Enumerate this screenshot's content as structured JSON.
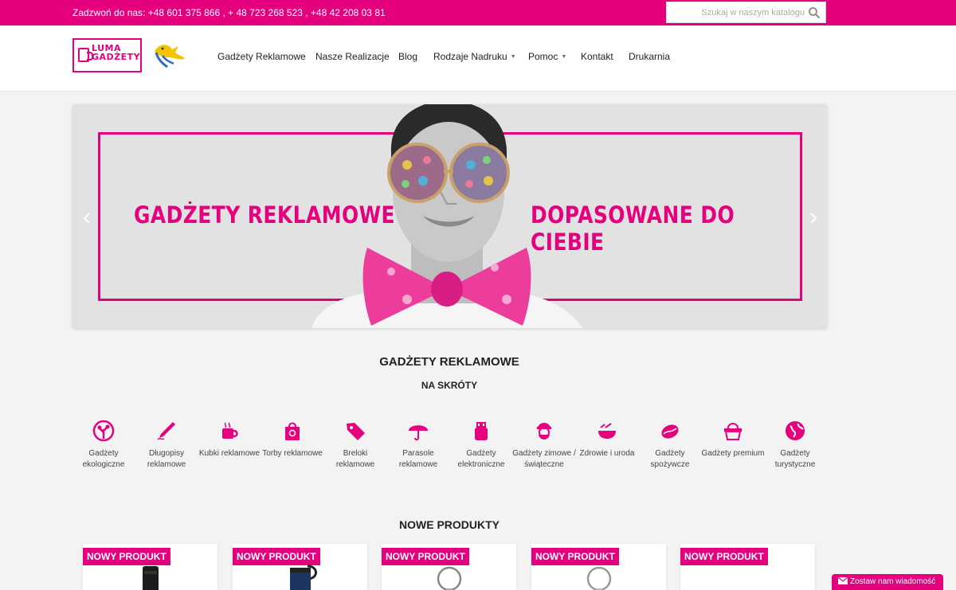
{
  "topbar": {
    "phones": "Zadzwoń do nas: +48 601 375 866 , + 48 723 268 523 , +48 42 208 03 81",
    "search_placeholder": "Szukaj w naszym katalogu"
  },
  "logo": {
    "line1": "LUMA",
    "line2": "GADŻETY"
  },
  "nav": {
    "items": [
      {
        "label": "Gadżety Reklamowe"
      },
      {
        "label": "Nasze Realizacje"
      },
      {
        "label": "Blog"
      },
      {
        "label": "Rodzaje Nadruku"
      },
      {
        "label": "Pomoc"
      },
      {
        "label": "Kontakt"
      },
      {
        "label": "Drukarnia"
      }
    ]
  },
  "slider": {
    "headline_left": "GADŻETY REKLAMOWE",
    "headline_right": "DOPASOWANE DO CIEBIE"
  },
  "section": {
    "title": "GADŻETY REKLAMOWE",
    "subtitle": "NA SKRÓTY"
  },
  "categories": [
    {
      "label": "Gadżety ekologiczne",
      "icon": "tree-icon"
    },
    {
      "label": "Długopisy reklamowe",
      "icon": "pen-icon"
    },
    {
      "label": "Kubki reklamowe",
      "icon": "mug-icon"
    },
    {
      "label": "Torby reklamowe",
      "icon": "bag-icon"
    },
    {
      "label": "Breloki reklamowe",
      "icon": "tag-icon"
    },
    {
      "label": "Parasole reklamowe",
      "icon": "umbrella-icon"
    },
    {
      "label": "Gadżety elektroniczne",
      "icon": "usb-icon"
    },
    {
      "label": "Gadżety zimowe / świąteczne",
      "icon": "santa-icon"
    },
    {
      "label": "Zdrowie i uroda",
      "icon": "bowl-icon"
    },
    {
      "label": "Gadżety spożywcze",
      "icon": "coffee-bean-icon"
    },
    {
      "label": "Gadżety premium",
      "icon": "basket-icon"
    },
    {
      "label": "Gadżety turystyczne",
      "icon": "globe-icon"
    }
  ],
  "products": {
    "title": "NOWE PRODUKTY",
    "items": [
      {
        "badge": "NOWY PRODUKT"
      },
      {
        "badge": "NOWY PRODUKT"
      },
      {
        "badge": "NOWY PRODUKT"
      },
      {
        "badge": "NOWY PRODUKT"
      },
      {
        "badge": "NOWY PRODUKT"
      }
    ]
  },
  "contact_widget": {
    "label": "Zostaw nam wiadomość"
  },
  "colors": {
    "accent": "#e5007e"
  }
}
